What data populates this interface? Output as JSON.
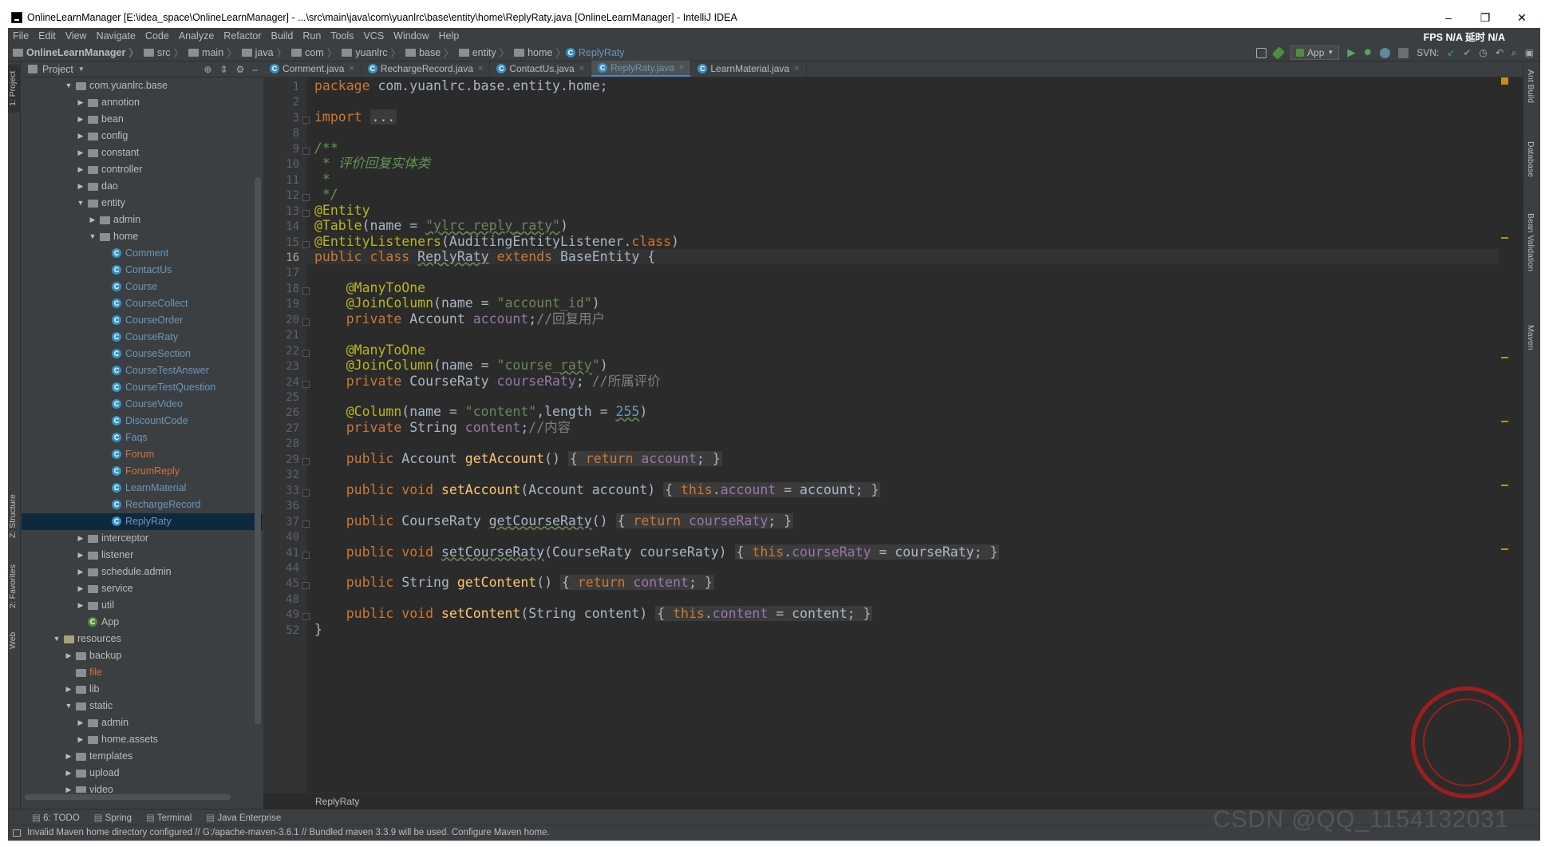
{
  "window": {
    "title": "OnlineLearnManager [E:\\idea_space\\OnlineLearnManager] - ...\\src\\main\\java\\com\\yuanlrc\\base\\entity\\home\\ReplyRaty.java [OnlineLearnManager] - IntelliJ IDEA",
    "min": "–",
    "max": "❐",
    "close": "✕"
  },
  "menu": [
    "File",
    "Edit",
    "View",
    "Navigate",
    "Code",
    "Analyze",
    "Refactor",
    "Build",
    "Run",
    "Tools",
    "VCS",
    "Window",
    "Help"
  ],
  "fps": "FPS  N/A  延时  N/A",
  "breadcrumb": [
    "OnlineLearnManager",
    "src",
    "main",
    "java",
    "com",
    "yuanlrc",
    "base",
    "entity",
    "home",
    "ReplyRaty"
  ],
  "toolbar": {
    "run_config": "App",
    "svn": "SVN:"
  },
  "left_tabs": {
    "project": "1: Project",
    "structure": "Z: Structure",
    "favorites": "2: Favorites",
    "web": "Web"
  },
  "right_tabs": {
    "ant": "Ant Build",
    "database": "Database",
    "bean": "Bean Validation",
    "maven": "Maven"
  },
  "project_panel": {
    "title": "Project"
  },
  "tree": [
    {
      "label": "com.yuanlrc.base",
      "kind": "pkg",
      "depth": 0,
      "open": true
    },
    {
      "label": "annotion",
      "kind": "pkg",
      "depth": 1
    },
    {
      "label": "bean",
      "kind": "pkg",
      "depth": 1
    },
    {
      "label": "config",
      "kind": "pkg",
      "depth": 1
    },
    {
      "label": "constant",
      "kind": "pkg",
      "depth": 1
    },
    {
      "label": "controller",
      "kind": "pkg",
      "depth": 1
    },
    {
      "label": "dao",
      "kind": "pkg",
      "depth": 1
    },
    {
      "label": "entity",
      "kind": "pkg",
      "depth": 1,
      "open": true
    },
    {
      "label": "admin",
      "kind": "pkg",
      "depth": 2
    },
    {
      "label": "home",
      "kind": "pkg",
      "depth": 2,
      "open": true
    },
    {
      "label": "Comment",
      "kind": "cls",
      "depth": 3
    },
    {
      "label": "ContactUs",
      "kind": "cls",
      "depth": 3
    },
    {
      "label": "Course",
      "kind": "cls",
      "depth": 3
    },
    {
      "label": "CourseCollect",
      "kind": "cls",
      "depth": 3
    },
    {
      "label": "CourseOrder",
      "kind": "cls",
      "depth": 3
    },
    {
      "label": "CourseRaty",
      "kind": "cls",
      "depth": 3
    },
    {
      "label": "CourseSection",
      "kind": "cls",
      "depth": 3
    },
    {
      "label": "CourseTestAnswer",
      "kind": "cls",
      "depth": 3
    },
    {
      "label": "CourseTestQuestion",
      "kind": "cls",
      "depth": 3
    },
    {
      "label": "CourseVideo",
      "kind": "cls",
      "depth": 3
    },
    {
      "label": "DiscountCode",
      "kind": "cls",
      "depth": 3
    },
    {
      "label": "Faqs",
      "kind": "cls",
      "depth": 3
    },
    {
      "label": "Forum",
      "kind": "cls",
      "depth": 3,
      "orange": true
    },
    {
      "label": "ForumReply",
      "kind": "cls",
      "depth": 3,
      "orange": true
    },
    {
      "label": "LearnMaterial",
      "kind": "cls",
      "depth": 3
    },
    {
      "label": "RechargeRecord",
      "kind": "cls",
      "depth": 3
    },
    {
      "label": "ReplyRaty",
      "kind": "cls",
      "depth": 3,
      "selected": true
    },
    {
      "label": "interceptor",
      "kind": "pkg",
      "depth": 1
    },
    {
      "label": "listener",
      "kind": "pkg",
      "depth": 1
    },
    {
      "label": "schedule.admin",
      "kind": "pkg",
      "depth": 1
    },
    {
      "label": "service",
      "kind": "pkg",
      "depth": 1
    },
    {
      "label": "util",
      "kind": "pkg",
      "depth": 1
    },
    {
      "label": "App",
      "kind": "app",
      "depth": 1
    },
    {
      "label": "resources",
      "kind": "res",
      "depth": -1,
      "open": true
    },
    {
      "label": "backup",
      "kind": "pkg",
      "depth": 0
    },
    {
      "label": "file",
      "kind": "file",
      "depth": 0
    },
    {
      "label": "lib",
      "kind": "pkg",
      "depth": 0
    },
    {
      "label": "static",
      "kind": "pkg",
      "depth": 0,
      "open": true
    },
    {
      "label": "admin",
      "kind": "pkg",
      "depth": 1
    },
    {
      "label": "home.assets",
      "kind": "pkg",
      "depth": 1
    },
    {
      "label": "templates",
      "kind": "pkg",
      "depth": 0
    },
    {
      "label": "upload",
      "kind": "pkg",
      "depth": 0
    },
    {
      "label": "video",
      "kind": "pkg",
      "depth": 0
    }
  ],
  "editor_tabs": [
    {
      "label": "Comment.java"
    },
    {
      "label": "RechargeRecord.java"
    },
    {
      "label": "ContactUs.java"
    },
    {
      "label": "ReplyRaty.java",
      "active": true
    },
    {
      "label": "LearnMaterial.java"
    }
  ],
  "current_line": "16",
  "code_lines": [
    {
      "n": "1",
      "html": "<span class='kw'>package</span> com.yuanlrc.base.entity.home;"
    },
    {
      "n": "2",
      "html": ""
    },
    {
      "n": "3",
      "html": "<span class='kw'>import</span> <span class='fb'>...</span>"
    },
    {
      "n": "8",
      "html": ""
    },
    {
      "n": "9",
      "html": "<span class='cm'>/**</span>"
    },
    {
      "n": "10",
      "html": "<span class='cm'> * 评价回复实体类</span>"
    },
    {
      "n": "11",
      "html": "<span class='cm'> *</span>"
    },
    {
      "n": "12",
      "html": "<span class='cm'> */</span>"
    },
    {
      "n": "13",
      "html": "<span class='an'>@Entity</span>"
    },
    {
      "n": "14",
      "html": "<span class='an'>@Table</span>(name = <span class='st ul'>\"ylrc_reply_raty\"</span>)"
    },
    {
      "n": "15",
      "html": "<span class='an'>@EntityListeners</span>(AuditingEntityListener.<span class='kw'>class</span>)"
    },
    {
      "n": "16",
      "html": "<span class='kw'>public class</span> <span class='ul'>ReplyRaty</span> <span class='kw'>extends</span> BaseEntity {"
    },
    {
      "n": "17",
      "html": ""
    },
    {
      "n": "18",
      "html": "    <span class='an'>@ManyToOne</span>"
    },
    {
      "n": "19",
      "html": "    <span class='an'>@JoinColumn</span>(name = <span class='st'>\"account_id\"</span>)"
    },
    {
      "n": "20",
      "html": "    <span class='kw'>private</span> Account <span class='fd'>account</span>;<span class='lc'>//回复用户</span>"
    },
    {
      "n": "21",
      "html": ""
    },
    {
      "n": "22",
      "html": "    <span class='an'>@ManyToOne</span>"
    },
    {
      "n": "23",
      "html": "    <span class='an'>@JoinColumn</span>(name = <span class='st'>\"course_<span class='ul'>raty</span>\"</span>)"
    },
    {
      "n": "24",
      "html": "    <span class='kw'>private</span> CourseRaty <span class='fd'>courseRaty</span>; <span class='lc'>//所属评价</span>"
    },
    {
      "n": "25",
      "html": ""
    },
    {
      "n": "26",
      "html": "    <span class='an'>@Column</span>(name = <span class='st'>\"content\"</span>,length = <span class='nm ul'>255</span>)"
    },
    {
      "n": "27",
      "html": "    <span class='kw'>private</span> String <span class='fd'>content</span>;<span class='lc'>//内容</span>"
    },
    {
      "n": "28",
      "html": ""
    },
    {
      "n": "29",
      "html": "    <span class='kw'>public</span> Account <span class='fn'>getAccount</span>() <span class='fb'>{ <span class='kw'>return</span> <span class='fd'>account</span>; }</span>"
    },
    {
      "n": "32",
      "html": ""
    },
    {
      "n": "33",
      "html": "    <span class='kw'>public void</span> <span class='fn'>setAccount</span>(Account account) <span class='fb'>{ <span class='kw'>this</span>.<span class='fd'>account</span> = account; }</span>"
    },
    {
      "n": "36",
      "html": ""
    },
    {
      "n": "37",
      "html": "    <span class='kw'>public</span> CourseRaty <span class='ul'>getCourseRaty</span>() <span class='fb'>{ <span class='kw'>return</span> <span class='fd'>courseRaty</span>; }</span>"
    },
    {
      "n": "40",
      "html": ""
    },
    {
      "n": "41",
      "html": "    <span class='kw'>public void</span> <span class='ul'>setCourseRaty</span>(CourseRaty courseRaty) <span class='fb'>{ <span class='kw'>this</span>.<span class='fd'>courseRaty</span> = courseRaty; }</span>"
    },
    {
      "n": "44",
      "html": ""
    },
    {
      "n": "45",
      "html": "    <span class='kw'>public</span> String <span class='fn'>getContent</span>() <span class='fb'>{ <span class='kw'>return</span> <span class='fd'>content</span>; }</span>"
    },
    {
      "n": "48",
      "html": ""
    },
    {
      "n": "49",
      "html": "    <span class='kw'>public void</span> <span class='fn'>setContent</span>(String content) <span class='fb'>{ <span class='kw'>this</span>.<span class='fd'>content</span> = content; }</span>"
    },
    {
      "n": "52",
      "html": "}"
    }
  ],
  "editor_crumb": "ReplyRaty",
  "bottom_tools": [
    "6: TODO",
    "Spring",
    "Terminal",
    "Java Enterprise"
  ],
  "status": "Invalid Maven home directory configured // G:/apache-maven-3.6.1 // Bundled maven 3.3.9 will be used.  Configure Maven home.",
  "watermark": "CSDN @QQ_1154132031",
  "colors": {
    "keyword": "#cc7832",
    "annotation": "#bbb529",
    "string": "#6a8759",
    "field": "#9876aa",
    "method": "#ffc66d",
    "class_link": "#6897bb"
  }
}
